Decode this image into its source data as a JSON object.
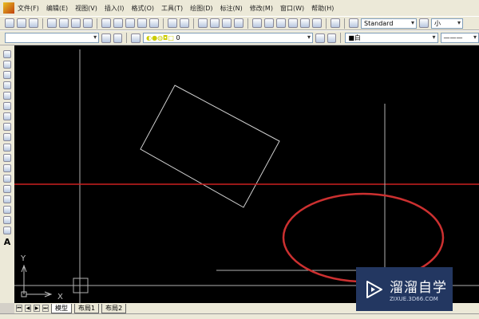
{
  "menu": [
    "文件(F)",
    "编辑(E)",
    "视图(V)",
    "插入(I)",
    "格式(O)",
    "工具(T)",
    "绘图(D)",
    "标注(N)",
    "修改(M)",
    "窗口(W)",
    "帮助(H)"
  ],
  "toolbar": {
    "text_style": "Standard",
    "height_value": "小"
  },
  "layers": {
    "current_layer": "0",
    "color": "白"
  },
  "ucs": {
    "x_label": "X",
    "y_label": "Y"
  },
  "tabs": [
    "模型",
    "布局1",
    "布局2"
  ],
  "watermark": {
    "name": "溜溜自学",
    "url": "ZIXUE.3D66.COM"
  },
  "colors": {
    "canvas": "#000000",
    "red_line": "#cc2020",
    "gray_line": "#b0b0b0"
  }
}
